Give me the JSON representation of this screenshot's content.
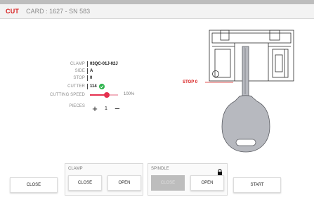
{
  "header": {
    "mode": "CUT",
    "card_info": "CARD : 1627 - SN 583"
  },
  "params": {
    "clamp_label": "CLAMP",
    "clamp_value": "03QC-01J-02J",
    "side_label": "SIDE",
    "side_value": "A",
    "stop_label": "STOP",
    "stop_value": "0",
    "cutter_label": "CUTTER",
    "cutter_value": "114",
    "cutting_speed_label": "CUTTING SPEED",
    "cutting_speed_value": "100%",
    "cutting_speed_fraction": 0.6,
    "pieces_label": "PIECES",
    "pieces_value": "1",
    "plus_glyph": "+",
    "minus_glyph": "−"
  },
  "diagram": {
    "stop_label": "STOP 0"
  },
  "bottom": {
    "close_label": "CLOSE",
    "clamp_group_label": "CLAMP",
    "clamp_close_label": "CLOSE",
    "clamp_open_label": "OPEN",
    "spindle_group_label": "SPINDLE",
    "spindle_close_label": "CLOSE",
    "spindle_open_label": "OPEN",
    "start_label": "START"
  },
  "colors": {
    "accent_red": "#d81e1e",
    "slider": "#e5304f",
    "success_green": "#2bb34a",
    "key_gray": "#b7b9bf"
  },
  "icons": {
    "check": "check-circle-icon",
    "lock": "lock-icon"
  }
}
